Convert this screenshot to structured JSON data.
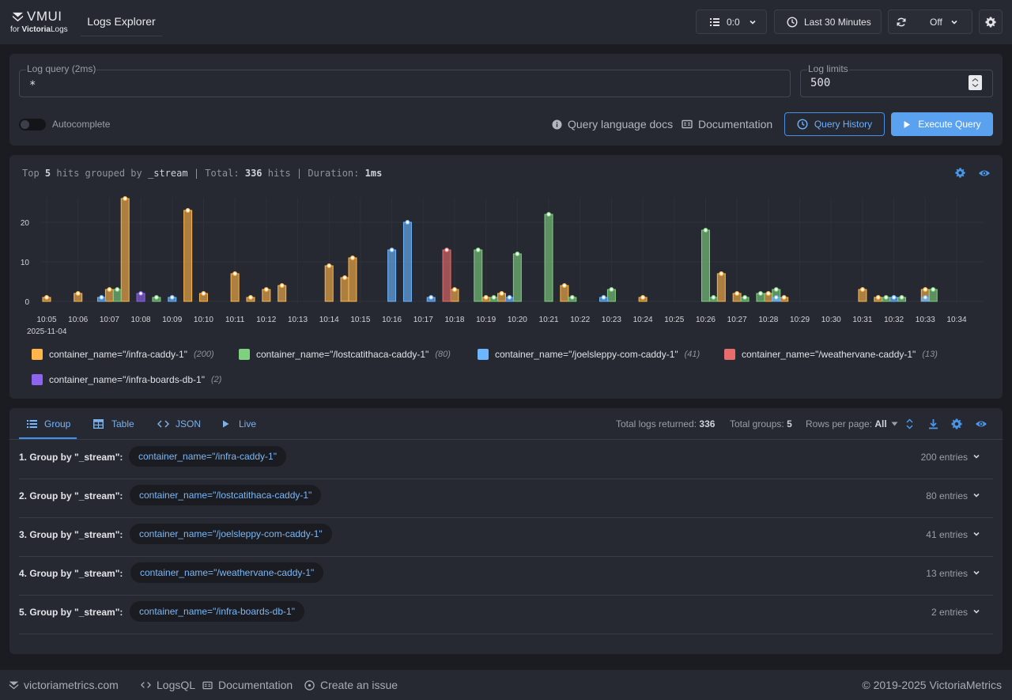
{
  "header": {
    "logo_name": "VMUI",
    "logo_sub_prefix": "for ",
    "logo_sub_bold": "Victoria",
    "logo_sub_suffix": "Logs",
    "app_title": "Logs Explorer",
    "tenant_label": "0:0",
    "time_range_label": "Last 30 Minutes",
    "refresh_label": "Off"
  },
  "query": {
    "query_legend": "Log query (2ms)",
    "query_value": "*",
    "limit_legend": "Log limits",
    "limit_value": "500",
    "autocomplete_label": "Autocomplete",
    "docs_link": "Query language docs",
    "documentation_link": "Documentation",
    "history_button": "Query History",
    "execute_button": "Execute Query"
  },
  "hits": {
    "prefix": "Top",
    "top": "5",
    "grouped_by_text": "hits grouped by",
    "group_field": "_stream",
    "total_label": "| Total:",
    "total": "336",
    "hits_word": "hits",
    "duration_label": "| Duration:",
    "duration": "1ms"
  },
  "chart_data": {
    "type": "bar",
    "date_label": "2025-11-04",
    "yticks": [
      0,
      10,
      20
    ],
    "ylim": [
      0,
      27
    ],
    "xtick_labels": [
      "10:05",
      "10:06",
      "10:07",
      "10:08",
      "10:09",
      "10:10",
      "10:11",
      "10:12",
      "10:13",
      "10:14",
      "10:15",
      "10:16",
      "10:17",
      "10:18",
      "10:19",
      "10:20",
      "10:21",
      "10:22",
      "10:23",
      "10:24",
      "10:25",
      "10:26",
      "10:27",
      "10:28",
      "10:29",
      "10:30",
      "10:31",
      "10:32",
      "10:33",
      "10:34"
    ],
    "series": [
      {
        "name": "container_name=\"/infra-caddy-1\"",
        "count": "(200)",
        "color": "#ffb54a",
        "points": [
          [
            "10:05",
            1
          ],
          [
            "10:06",
            2
          ],
          [
            "10:07",
            3
          ],
          [
            "10:07:30",
            26
          ],
          [
            "10:09:30",
            23
          ],
          [
            "10:10",
            2
          ],
          [
            "10:11",
            7
          ],
          [
            "10:11:30",
            1
          ],
          [
            "10:12",
            3
          ],
          [
            "10:12:30",
            4
          ],
          [
            "10:14",
            9
          ],
          [
            "10:14:30",
            6
          ],
          [
            "10:14:45",
            11
          ],
          [
            "10:18",
            3
          ],
          [
            "10:19",
            1
          ],
          [
            "10:19:30",
            2
          ],
          [
            "10:21:30",
            4
          ],
          [
            "10:24",
            1
          ],
          [
            "10:26:30",
            7
          ],
          [
            "10:27",
            2
          ],
          [
            "10:28",
            2
          ],
          [
            "10:28:30",
            1
          ],
          [
            "10:31",
            3
          ],
          [
            "10:31:30",
            1
          ],
          [
            "10:33",
            3
          ]
        ]
      },
      {
        "name": "container_name=\"/lostcatithaca-caddy-1\"",
        "count": "(80)",
        "color": "#7ed17e",
        "points": [
          [
            "10:07:15",
            3
          ],
          [
            "10:08:30",
            1
          ],
          [
            "10:18:45",
            13
          ],
          [
            "10:19:15",
            1
          ],
          [
            "10:20",
            12
          ],
          [
            "10:21",
            22
          ],
          [
            "10:21:45",
            1
          ],
          [
            "10:23",
            3
          ],
          [
            "10:26",
            18
          ],
          [
            "10:26:15",
            1
          ],
          [
            "10:27:15",
            1
          ],
          [
            "10:27:45",
            2
          ],
          [
            "10:28:15",
            3
          ],
          [
            "10:31:45",
            1
          ],
          [
            "10:32:15",
            1
          ],
          [
            "10:33:15",
            3
          ]
        ]
      },
      {
        "name": "container_name=\"/joelsleppy-com-caddy-1\"",
        "count": "(41)",
        "color": "#6cb7ff",
        "points": [
          [
            "10:06:45",
            1
          ],
          [
            "10:09",
            1
          ],
          [
            "10:16",
            13
          ],
          [
            "10:16:30",
            20
          ],
          [
            "10:17:15",
            1
          ],
          [
            "10:19:45",
            1
          ],
          [
            "10:22:45",
            1
          ],
          [
            "10:28:15",
            1
          ],
          [
            "10:32",
            1
          ],
          [
            "10:33",
            1
          ]
        ]
      },
      {
        "name": "container_name=\"/weathervane-caddy-1\"",
        "count": "(13)",
        "color": "#e86c6c",
        "points": [
          [
            "10:17:45",
            13
          ]
        ]
      },
      {
        "name": "container_name=\"/infra-boards-db-1\"",
        "count": "(2)",
        "color": "#8e63f0",
        "points": [
          [
            "10:08",
            2
          ]
        ]
      }
    ]
  },
  "results": {
    "tabs": [
      "Group",
      "Table",
      "JSON",
      "Live"
    ],
    "total_logs_label": "Total logs returned:",
    "total_logs": "336",
    "total_groups_label": "Total groups:",
    "total_groups": "5",
    "rows_per_page_label": "Rows per page:",
    "rows_per_page": "All",
    "groups": [
      {
        "title": "1. Group by \"_stream\":",
        "chip": "container_name=\"/infra-caddy-1\"",
        "count": "200 entries"
      },
      {
        "title": "2. Group by \"_stream\":",
        "chip": "container_name=\"/lostcatithaca-caddy-1\"",
        "count": "80 entries"
      },
      {
        "title": "3. Group by \"_stream\":",
        "chip": "container_name=\"/joelsleppy-com-caddy-1\"",
        "count": "41 entries"
      },
      {
        "title": "4. Group by \"_stream\":",
        "chip": "container_name=\"/weathervane-caddy-1\"",
        "count": "13 entries"
      },
      {
        "title": "5. Group by \"_stream\":",
        "chip": "container_name=\"/infra-boards-db-1\"",
        "count": "2 entries"
      }
    ]
  },
  "footer": {
    "site": "victoriametrics.com",
    "logsql": "LogsQL",
    "documentation": "Documentation",
    "issue": "Create an issue",
    "copyright": "© 2019-2025 VictoriaMetrics"
  }
}
